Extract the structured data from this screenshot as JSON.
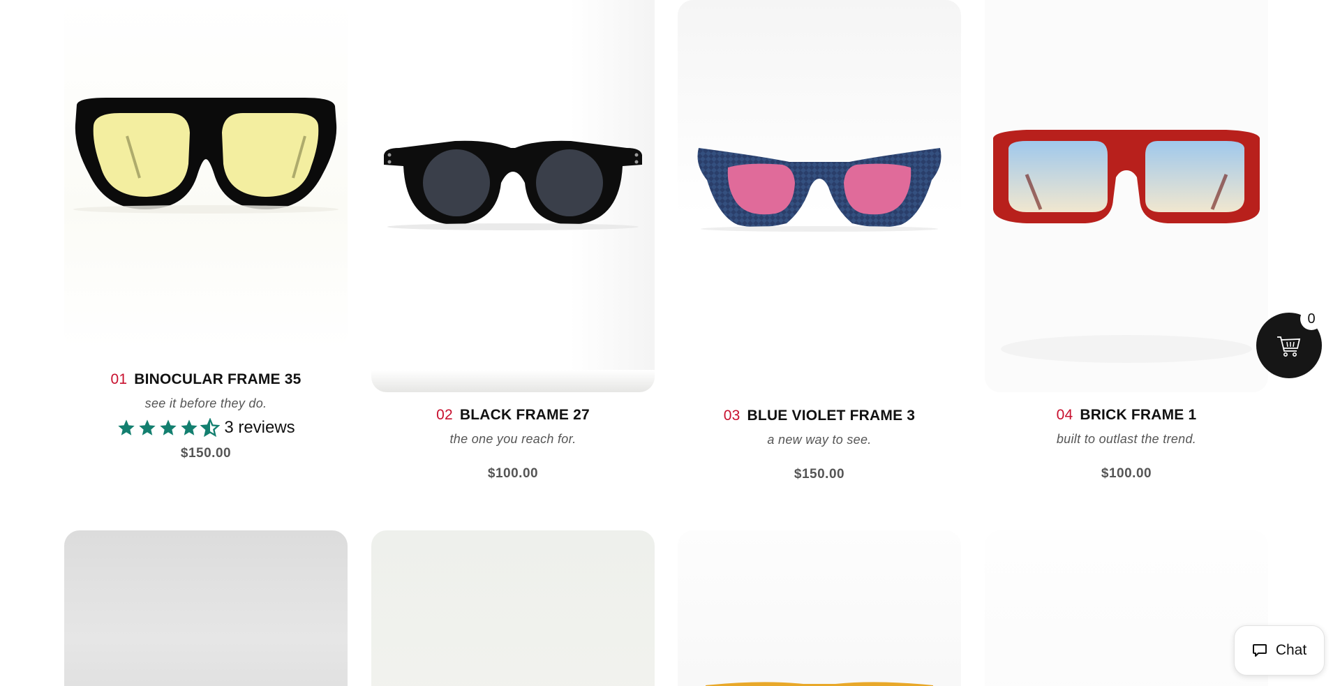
{
  "products": [
    {
      "num": "01",
      "name": "BINOCULAR FRAME 35",
      "tagline": "see it before they do.",
      "price": "$150.00",
      "rating": 4.5,
      "reviews": "3 reviews",
      "lens_color": "#f3eea0",
      "frame_color": "#0b0b0b"
    },
    {
      "num": "02",
      "name": "BLACK FRAME 27",
      "tagline": "the one you reach for.",
      "price": "$100.00",
      "lens_color": "#3a3f4a",
      "frame_color": "#0d0d0d"
    },
    {
      "num": "03",
      "name": "BLUE VIOLET FRAME 3",
      "tagline": "a new way to see.",
      "price": "$150.00",
      "lens_color": "#e06b9a",
      "frame_color": "#2a3e6a"
    },
    {
      "num": "04",
      "name": "BRICK FRAME 1",
      "tagline": "built to outlast the trend.",
      "price": "$100.00",
      "lens_color": "#bcd9ef",
      "frame_color": "#b8201c"
    }
  ],
  "accent_color": "#c8102e",
  "star_color": "#137f6f",
  "cart": {
    "count": "0",
    "icon": "cart-icon"
  },
  "chat": {
    "label": "Chat",
    "icon": "chat-bubble-icon"
  }
}
